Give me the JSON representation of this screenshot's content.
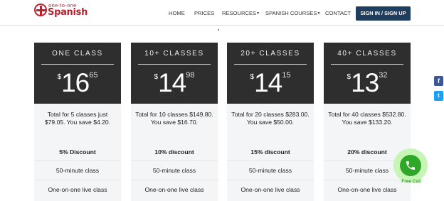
{
  "header": {
    "logo_top": "one-to-one",
    "logo_main": "Spanish",
    "nav": [
      {
        "label": "HOME",
        "dropdown": false
      },
      {
        "label": "PRICES",
        "dropdown": false
      },
      {
        "label": "RESOURCES",
        "dropdown": true
      },
      {
        "label": "SPANISH COURSES",
        "dropdown": true
      },
      {
        "label": "CONTACT",
        "dropdown": false
      }
    ],
    "signin_label": "SIGN IN / SIGN UP"
  },
  "plans": [
    {
      "title": "ONE CLASS",
      "currency": "$",
      "price_whole": "16",
      "price_cents": "65",
      "description": "Total for 5 classes just $79.05. You save $4.20.",
      "discount": "5% Discount",
      "duration": "50-minute class",
      "format": "One-on-one live class"
    },
    {
      "title": "10+ CLASSES",
      "currency": "$",
      "price_whole": "14",
      "price_cents": "98",
      "description": "Total for 10 classes $149.80. You save $16.70.",
      "discount": "10% discount",
      "duration": "50-minute class",
      "format": "One-on-one live class"
    },
    {
      "title": "20+ CLASSES",
      "currency": "$",
      "price_whole": "14",
      "price_cents": "15",
      "description": "Total for 20 classes $283.00. You save $50.00.",
      "discount": "15% discount",
      "duration": "50-minute class",
      "format": "One-on-one live class"
    },
    {
      "title": "40+ CLASSES",
      "currency": "$",
      "price_whole": "13",
      "price_cents": "32",
      "description": "Total for 40 classes $532.80. You save $133.20.",
      "discount": "20% discount",
      "duration": "50-minute class",
      "format": "One-on-one live class"
    }
  ],
  "social": {
    "facebook": "f",
    "twitter": "t",
    "facebook_icon": "facebook-icon",
    "twitter_icon": "twitter-icon"
  },
  "free_call": {
    "label": "Free Call",
    "icon": "phone-icon",
    "color": "#2fa829"
  },
  "colors": {
    "brand": "#b5232f",
    "signin": "#1f3d5c",
    "card_head": "#2e2e2e"
  }
}
